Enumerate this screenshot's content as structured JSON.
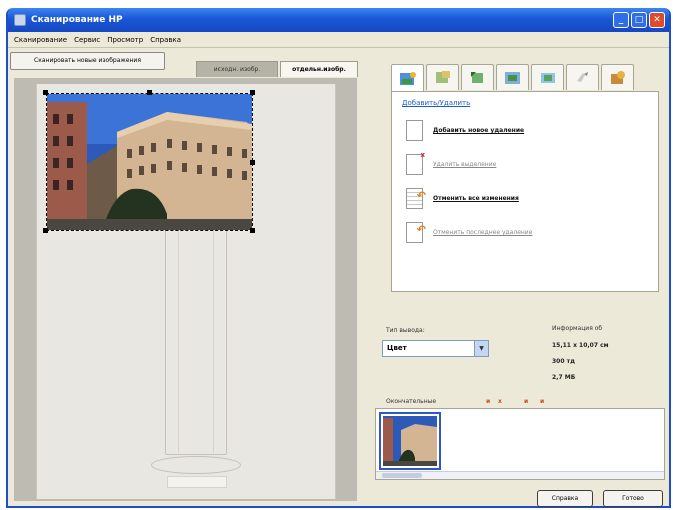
{
  "window": {
    "title": "Сканирование HP"
  },
  "title_buttons": {
    "minimize": "_",
    "maximize": "□",
    "close": "✕"
  },
  "menu": [
    "Сканирование",
    "Сервис",
    "Просмотр",
    "Справка"
  ],
  "toolbar": {
    "scan_new_label": "Сканировать новые изображения"
  },
  "view_tabs": [
    {
      "label": "исходн. изобр."
    },
    {
      "label": "отдельн.изобр."
    }
  ],
  "tools": {
    "tabs": [
      "add-remove",
      "crop",
      "rotate",
      "resize",
      "image-adjust",
      "color-correct",
      "sharpen"
    ],
    "active_tab": "add-remove",
    "panel_title": "Добавить/Удалить",
    "actions": [
      {
        "label": "Добавить новое удаление",
        "enabled": true
      },
      {
        "label": "Удалить выделение",
        "enabled": false
      },
      {
        "label": "Отменить все изменения",
        "enabled": true
      },
      {
        "label": "Отменить последнее удаление",
        "enabled": false
      }
    ]
  },
  "output": {
    "type_label": "Тип вывода:",
    "type_value": "Цвет",
    "info_label": "Информация об",
    "size": "15,11 x 10,07 см",
    "resolution": "300 тд",
    "filesize": "2,7 МБ"
  },
  "thumbnails": {
    "label": "Окончательные",
    "markers": [
      "и",
      "x",
      "и",
      "и"
    ]
  },
  "footer": {
    "help_label": "Справка",
    "done_label": "Готово"
  },
  "colors": {
    "titlebar": "#1a56d6",
    "window_bg": "#ece9d8",
    "link": "#1c5bd6",
    "marker": "#d64a1a"
  }
}
